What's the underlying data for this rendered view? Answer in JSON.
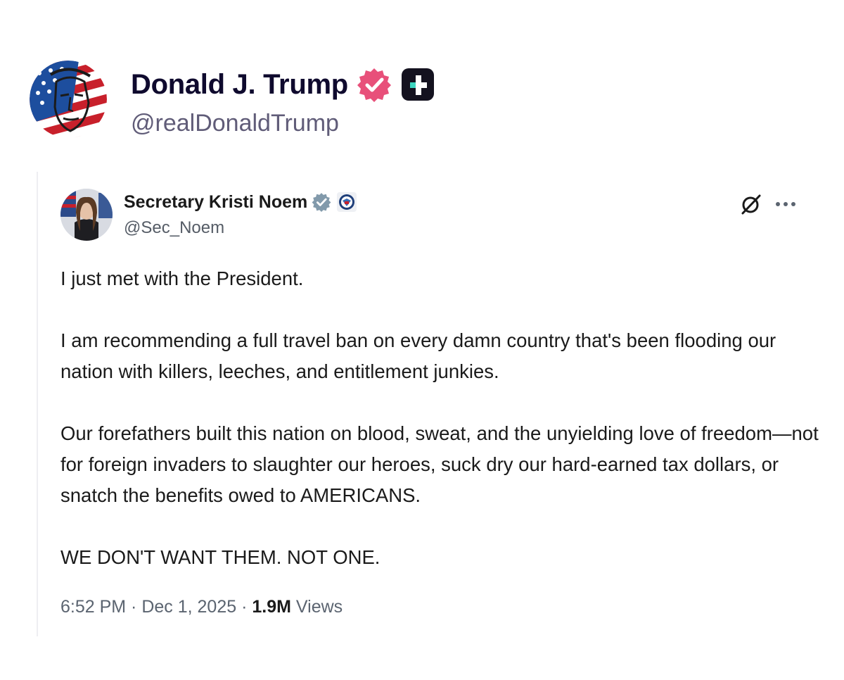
{
  "post": {
    "author_name": "Donald J. Trump",
    "author_handle": "@realDonaldTrump"
  },
  "embedded_tweet": {
    "author_name": "Secretary Kristi Noem",
    "author_handle": "@Sec_Noem",
    "paragraphs": [
      "I just met with the President.",
      "I am recommending a full travel ban on every damn country that's been flooding our nation with killers, leeches, and entitlement junkies.",
      "Our forefathers built this nation on blood, sweat, and the unyielding love of freedom—not for foreign invaders to slaughter our heroes, suck dry our hard-earned tax dollars, or snatch the benefits owed to AMERICANS.",
      "WE DON'T WANT THEM. NOT ONE."
    ],
    "time": "6:52 PM",
    "separator": " · ",
    "date": "Dec 1, 2025",
    "views_count": "1.9M",
    "views_label": " Views"
  },
  "icons": {
    "main_verified": "verified-badge-icon",
    "truth_plus": "truth-plus-icon",
    "embed_verified": "verified-badge-icon",
    "embed_affiliation": "dhs-seal-icon",
    "grok": "grok-icon",
    "more": "more-options-icon"
  },
  "colors": {
    "name_text": "#0f0a2e",
    "handle_text": "#605c78",
    "verified_pink": "#e8507a",
    "embed_verified_gray": "#829aab",
    "body_text": "#1a1a1a",
    "meta_text": "#5b6470"
  }
}
